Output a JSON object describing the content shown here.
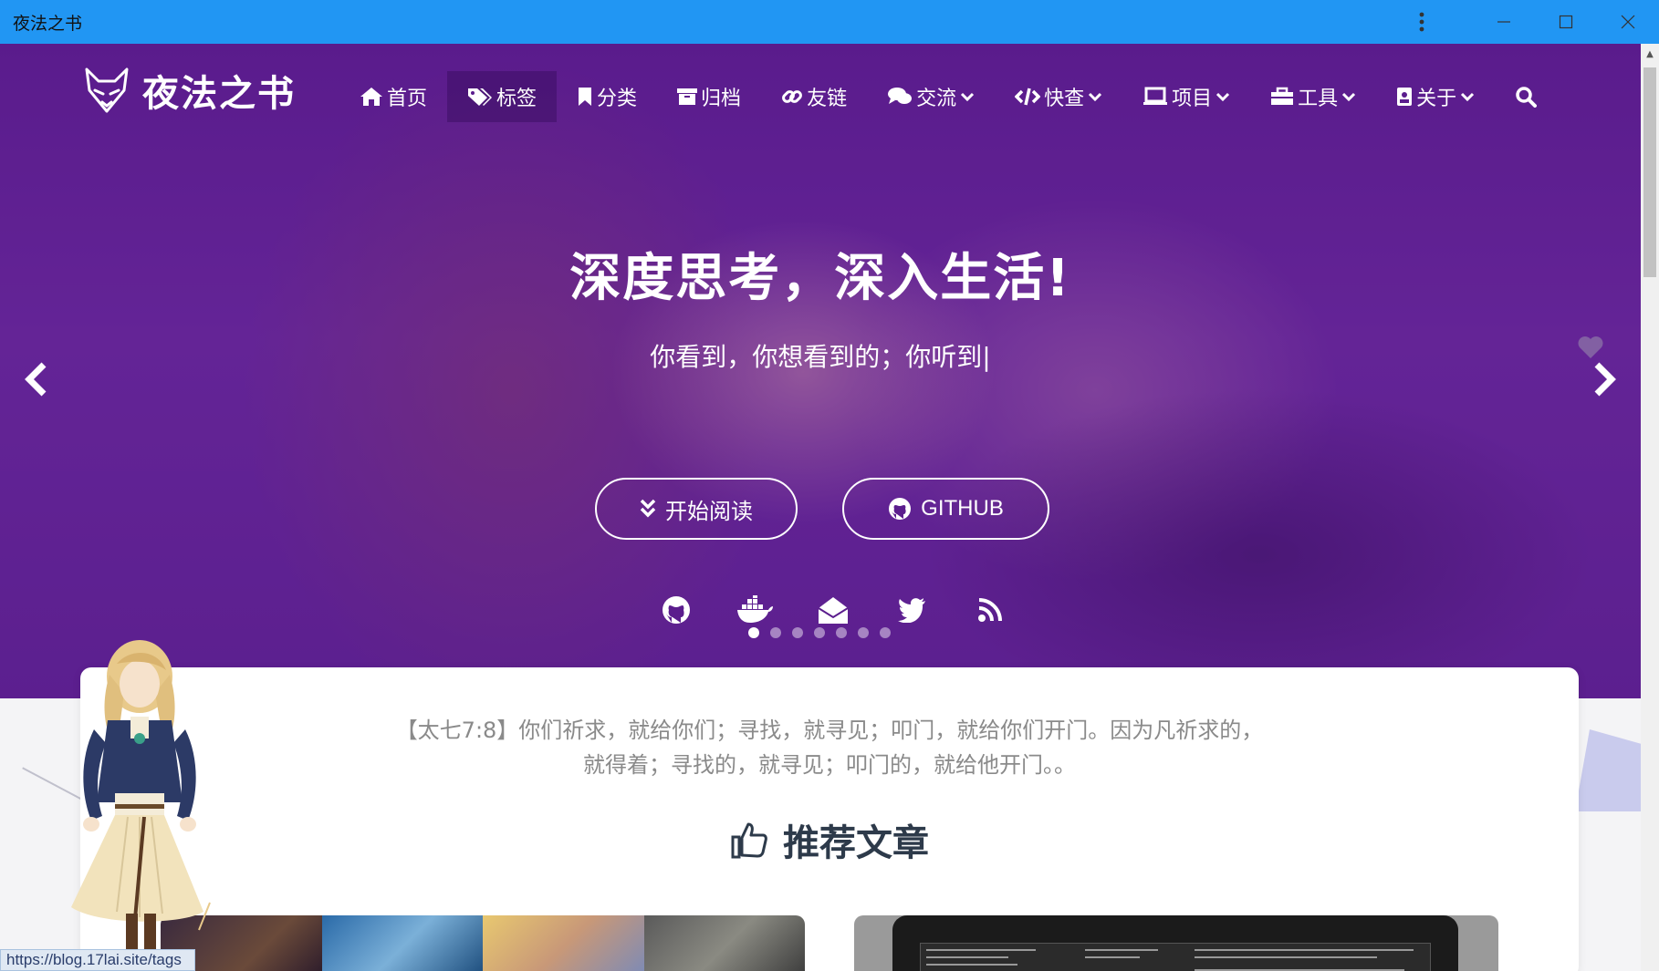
{
  "window": {
    "title": "夜法之书"
  },
  "brand": {
    "name": "夜法之书"
  },
  "nav": [
    {
      "label": "首页",
      "icon": "home-icon"
    },
    {
      "label": "标签",
      "icon": "tags-icon"
    },
    {
      "label": "分类",
      "icon": "bookmark-icon"
    },
    {
      "label": "归档",
      "icon": "archive-icon"
    },
    {
      "label": "友链",
      "icon": "link-icon"
    },
    {
      "label": "交流",
      "icon": "comments-icon"
    },
    {
      "label": "快查",
      "icon": "code-icon"
    },
    {
      "label": "项目",
      "icon": "laptop-icon"
    },
    {
      "label": "工具",
      "icon": "toolbox-icon"
    },
    {
      "label": "关于",
      "icon": "id-card-icon"
    }
  ],
  "hero": {
    "title": "深度思考，深入生活!",
    "subtitle": "你看到，你想看到的；你听到|",
    "read_button": "开始阅读",
    "github_button": "GITHUB",
    "slide_count": 7,
    "active_slide": 1
  },
  "content": {
    "verse_line1": "【太七7:8】你们祈求，就给你们；寻找，就寻见；叩门，就给你们开门。因为凡祈求的，",
    "verse_line2": "就得着；寻找的，就寻见；叩门的，就给他开门。。",
    "recommended_heading": "推荐文章"
  },
  "status": {
    "url": "https://blog.17lai.site/tags"
  },
  "colors": {
    "titlebar": "#2196f3",
    "hero_overlay": "#5b1d8d"
  }
}
